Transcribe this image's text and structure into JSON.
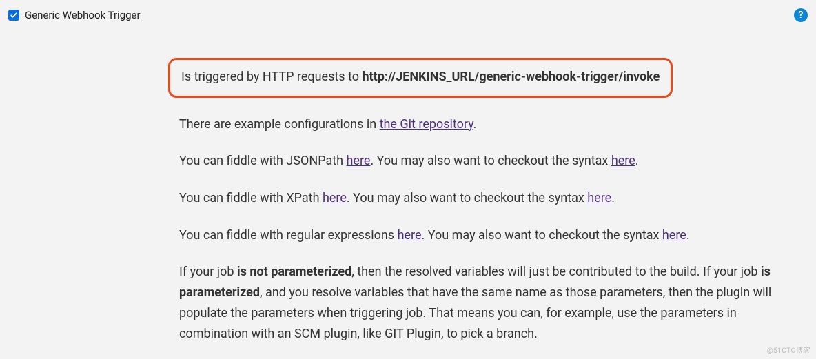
{
  "header": {
    "checkbox_checked": true,
    "label": "Generic Webhook Trigger",
    "help_glyph": "?"
  },
  "callout": {
    "prefix": "Is triggered by HTTP requests to ",
    "url": "http://JENKINS_URL/generic-webhook-trigger/invoke"
  },
  "para1": {
    "t1": "There are example configurations in ",
    "link1": "the Git repository",
    "t2": "."
  },
  "para2": {
    "t1": "You can fiddle with JSONPath ",
    "link1": "here",
    "t2": ". You may also want to checkout the syntax ",
    "link2": "here",
    "t3": "."
  },
  "para3": {
    "t1": "You can fiddle with XPath ",
    "link1": "here",
    "t2": ". You may also want to checkout the syntax ",
    "link2": "here",
    "t3": "."
  },
  "para4": {
    "t1": "You can fiddle with regular expressions ",
    "link1": "here",
    "t2": ". You may also want to checkout the syntax ",
    "link2": "here",
    "t3": "."
  },
  "para5": {
    "t1": "If your job ",
    "b1": "is not parameterized",
    "t2": ", then the resolved variables will just be contributed to the build. If your job ",
    "b2": "is parameterized",
    "t3": ", and you resolve variables that have the same name as those parameters, then the plugin will populate the parameters when triggering job. That means you can, for example, use the parameters in combination with an SCM plugin, like GIT Plugin, to pick a branch."
  },
  "watermark": "@51CTO博客"
}
